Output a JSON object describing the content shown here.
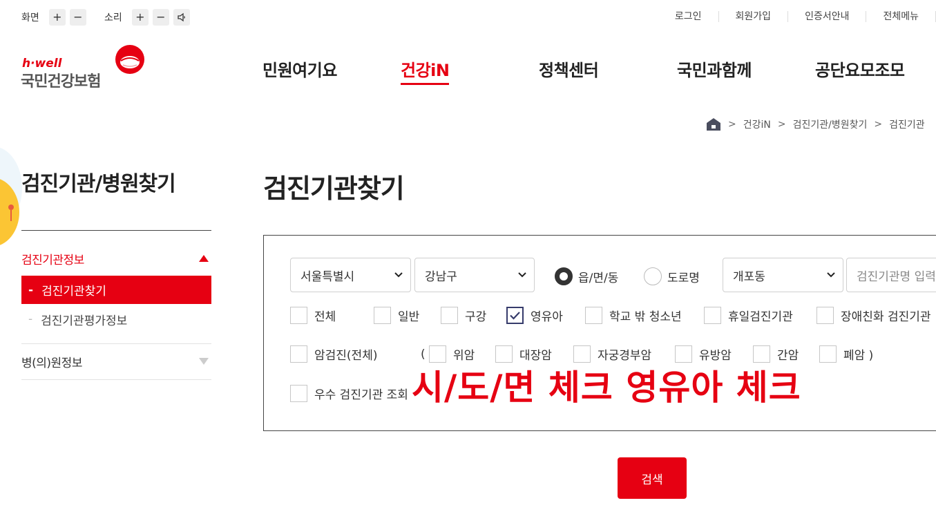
{
  "utility": {
    "screen_label": "화면",
    "sound_label": "소리",
    "plus": "+",
    "minus": "−",
    "links": [
      "로그인",
      "회원가입",
      "인증서안내",
      "전체메뉴"
    ]
  },
  "logo": {
    "tagline": "h·well",
    "name": "국민건강보험"
  },
  "gnb": [
    "민원여기요",
    "건강iN",
    "정책센터",
    "국민과함께",
    "공단요모조모"
  ],
  "breadcrumb": [
    "건강iN",
    "검진기관/병원찾기",
    "검진기관"
  ],
  "side": {
    "title": "검진기관/병원찾기",
    "section1": "검진기관정보",
    "sub_active": "검진기관찾기",
    "sub_other": "검진기관평가정보",
    "section2": "병(의)원정보"
  },
  "page_title": "검진기관찾기",
  "form": {
    "sido": "서울특별시",
    "sigungu": "강남구",
    "radio_dong": "읍/면/동",
    "radio_road": "도로명",
    "dong": "개포동",
    "name_placeholder": "검진기관명 입력",
    "checks_row1": [
      "전체",
      "일반",
      "구강",
      "영유아",
      "학교 밖 청소년",
      "휴일검진기관",
      "장애친화 검진기관"
    ],
    "cancer_all": "암검진(전체)",
    "paren_open": "(",
    "checks_cancer": [
      "위암",
      "대장암",
      "자궁경부암",
      "유방암",
      "간암",
      "폐암 )"
    ],
    "excellent": "우수 검진기관 조회",
    "checked": [
      "영유아"
    ],
    "radio_selected": "읍/면/동"
  },
  "annotation": "시/도/면 체크 영유아 체크",
  "search_button": "검색",
  "colors": {
    "brand_red": "#e60012",
    "checkbox_navy": "#363b6b"
  }
}
